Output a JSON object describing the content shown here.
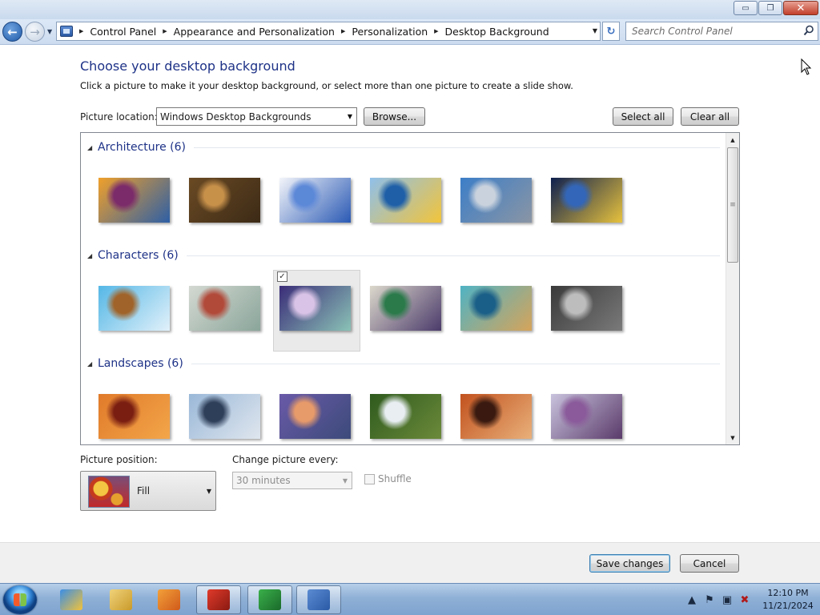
{
  "window": {
    "minimize_glyph": "▭",
    "restore_glyph": "❐",
    "close_glyph": "✕"
  },
  "nav": {
    "breadcrumbs": [
      "Control Panel",
      "Appearance and Personalization",
      "Personalization",
      "Desktop Background"
    ],
    "search_placeholder": "Search Control Panel"
  },
  "page": {
    "title": "Choose your desktop background",
    "subtitle": "Click a picture to make it your desktop background, or select more than one picture to create a slide show."
  },
  "location": {
    "label": "Picture location:",
    "value": "Windows Desktop Backgrounds",
    "browse_label": "Browse...",
    "select_all_label": "Select all",
    "clear_all_label": "Clear all"
  },
  "gallery": {
    "groups": [
      {
        "title": "Architecture (6)",
        "thumbs": [
          {
            "name": "architecture-1",
            "selected": false,
            "colors": [
              "#f0a02a",
              "#7b2a6a",
              "#2d5fa6"
            ]
          },
          {
            "name": "architecture-2",
            "selected": false,
            "colors": [
              "#6a4a24",
              "#c8914a",
              "#3c2a16"
            ]
          },
          {
            "name": "architecture-3",
            "selected": false,
            "colors": [
              "#f3f5fa",
              "#5c88d8",
              "#2a59b4"
            ]
          },
          {
            "name": "architecture-4",
            "selected": false,
            "colors": [
              "#8fc0ea",
              "#1e5fa8",
              "#f2c43a"
            ]
          },
          {
            "name": "architecture-5",
            "selected": false,
            "colors": [
              "#3c7ec8",
              "#c9d2dd",
              "#8a95a4"
            ]
          },
          {
            "name": "architecture-6",
            "selected": false,
            "colors": [
              "#0e1f4e",
              "#3366b8",
              "#e7c23d"
            ]
          }
        ]
      },
      {
        "title": "Characters (6)",
        "thumbs": [
          {
            "name": "characters-1",
            "selected": false,
            "colors": [
              "#54b7e6",
              "#a0642a",
              "#e2f1fa"
            ]
          },
          {
            "name": "characters-2",
            "selected": false,
            "colors": [
              "#d4d9d2",
              "#b24a3a",
              "#8aa59a"
            ]
          },
          {
            "name": "characters-3",
            "selected": true,
            "colors": [
              "#3a2c78",
              "#d9c3e6",
              "#8ac2b6"
            ]
          },
          {
            "name": "characters-4",
            "selected": false,
            "colors": [
              "#dcd8cc",
              "#2a7a4a",
              "#4a3a6a"
            ]
          },
          {
            "name": "characters-5",
            "selected": false,
            "colors": [
              "#4fb3c4",
              "#1a5f88",
              "#d6a45a"
            ]
          },
          {
            "name": "characters-6",
            "selected": false,
            "colors": [
              "#3a3a3a",
              "#bdbdbd",
              "#7a7a7a"
            ]
          }
        ]
      },
      {
        "title": "Landscapes (6)",
        "thumbs": [
          {
            "name": "landscapes-1",
            "selected": false,
            "colors": [
              "#e07a2a",
              "#7a1e12",
              "#f3a64a"
            ]
          },
          {
            "name": "landscapes-2",
            "selected": false,
            "colors": [
              "#9ab8d8",
              "#2e3f5a",
              "#dfe6ee"
            ]
          },
          {
            "name": "landscapes-3",
            "selected": false,
            "colors": [
              "#6a5aa8",
              "#e79a6a",
              "#3c4a7a"
            ]
          },
          {
            "name": "landscapes-4",
            "selected": false,
            "colors": [
              "#2e5a1e",
              "#e8eef2",
              "#6c8a3a"
            ]
          },
          {
            "name": "landscapes-5",
            "selected": false,
            "colors": [
              "#c2521e",
              "#3a1a10",
              "#e9b07a"
            ]
          },
          {
            "name": "landscapes-6",
            "selected": false,
            "colors": [
              "#c9c3dd",
              "#8a5a9a",
              "#5a3a6a"
            ]
          }
        ]
      }
    ]
  },
  "position": {
    "label": "Picture position:",
    "value": "Fill"
  },
  "interval": {
    "label": "Change picture every:",
    "value": "30 minutes",
    "shuffle_label": "Shuffle"
  },
  "footer": {
    "save_label": "Save changes",
    "cancel_label": "Cancel"
  },
  "taskbar": {
    "items": [
      {
        "name": "internet-explorer",
        "active": false,
        "colors": [
          "#3a8ee6",
          "#f2c23a"
        ]
      },
      {
        "name": "windows-explorer",
        "active": false,
        "colors": [
          "#f0d27a",
          "#c99a2a"
        ]
      },
      {
        "name": "media-player",
        "active": false,
        "colors": [
          "#f2a03a",
          "#d05a1a"
        ]
      },
      {
        "name": "app-red",
        "active": true,
        "colors": [
          "#e03a2a",
          "#8a1a12"
        ]
      },
      {
        "name": "app-green",
        "active": true,
        "colors": [
          "#3ab04a",
          "#1a6a2a"
        ]
      },
      {
        "name": "control-panel",
        "active": true,
        "colors": [
          "#5b8bd2",
          "#2a5aa5"
        ]
      }
    ],
    "time": "12:10 PM",
    "date": "11/21/2024"
  }
}
